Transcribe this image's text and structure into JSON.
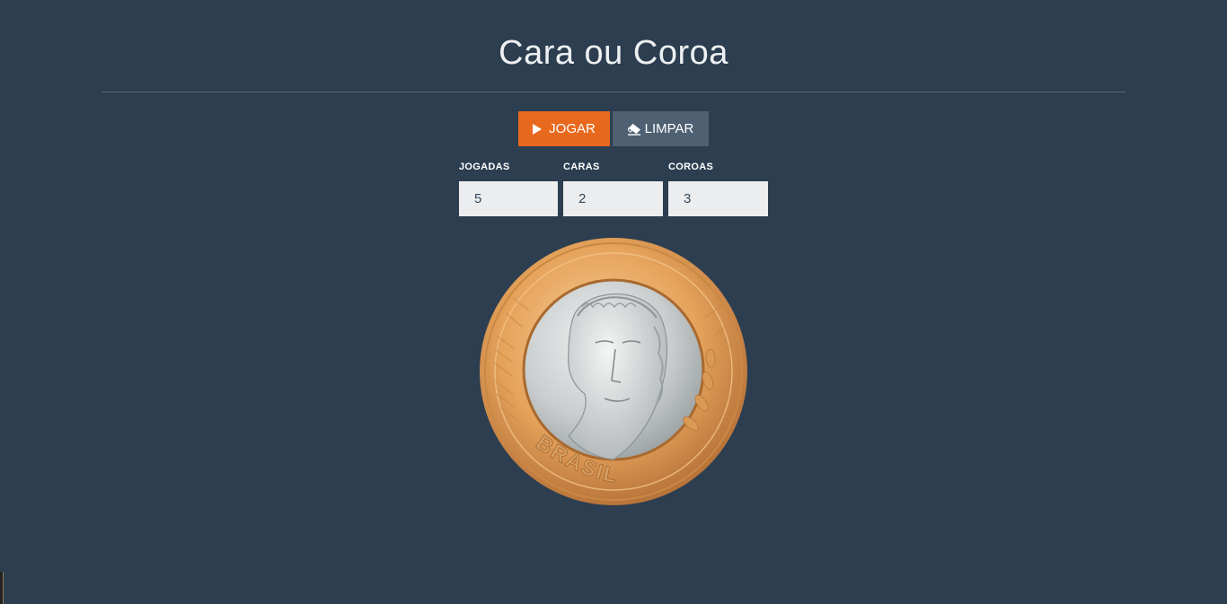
{
  "app": {
    "title": "Cara ou Coroa"
  },
  "controls": {
    "play_label": "JOGAR",
    "clear_label": "LIMPAR"
  },
  "stats": {
    "plays_label": "JOGADAS",
    "plays_value": "5",
    "heads_label": "CARAS",
    "heads_value": "2",
    "tails_label": "COROAS",
    "tails_value": "3"
  },
  "coin": {
    "inscription": "BRASIL",
    "side": "cara"
  },
  "colors": {
    "background": "#2c3e50",
    "play_button": "#e8691e",
    "clear_button": "#4e6072",
    "input_bg": "#ecedee",
    "coin_outer": "#e8a860",
    "coin_inner": "#c8cccc"
  }
}
